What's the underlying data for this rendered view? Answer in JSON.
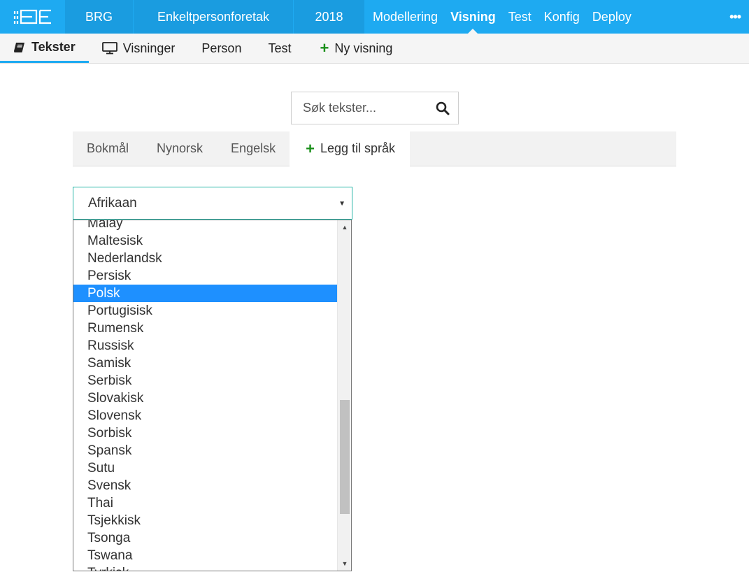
{
  "topbar": {
    "context": [
      "BRG",
      "Enkeltpersonforetak",
      "2018"
    ],
    "nav": [
      "Modellering",
      "Visning",
      "Test",
      "Konfig",
      "Deploy"
    ],
    "active_nav": "Visning",
    "more": "•••"
  },
  "subtabs": {
    "tekster": "Tekster",
    "visninger": "Visninger",
    "person": "Person",
    "test": "Test",
    "ny_visning": "Ny visning"
  },
  "search": {
    "placeholder": "Søk tekster..."
  },
  "languages": {
    "tabs": [
      "Bokmål",
      "Nynorsk",
      "Engelsk"
    ],
    "add": "Legg til språk"
  },
  "language_select": {
    "selected": "Afrikaan",
    "visible_options": [
      "Malay",
      "Maltesisk",
      "Nederlandsk",
      "Persisk",
      "Polsk",
      "Portugisisk",
      "Rumensk",
      "Russisk",
      "Samisk",
      "Serbisk",
      "Slovakisk",
      "Slovensk",
      "Sorbisk",
      "Spansk",
      "Sutu",
      "Svensk",
      "Thai",
      "Tsjekkisk",
      "Tsonga",
      "Tswana",
      "Tyrkisk"
    ],
    "highlighted": "Polsk"
  },
  "colors": {
    "topbar": "#1eaaf1",
    "context_bg": "#1a9ce0",
    "highlight": "#1e90ff",
    "add_green": "#1a8f1a",
    "select_border": "#29b6a8"
  }
}
